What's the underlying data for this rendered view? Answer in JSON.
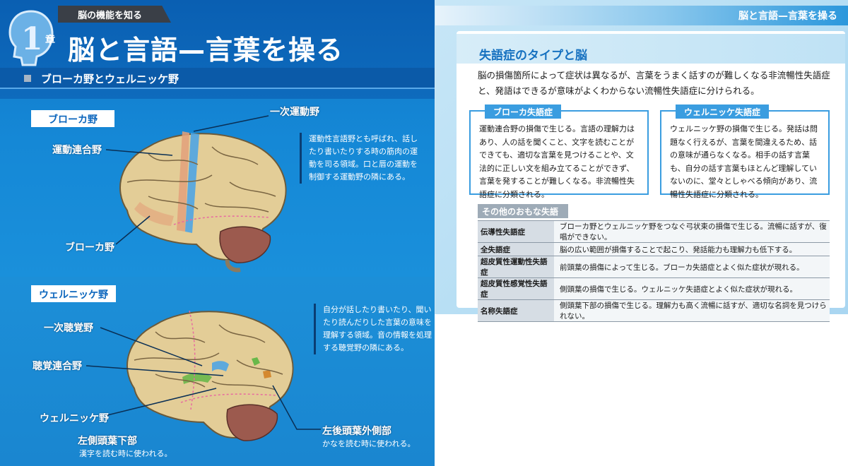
{
  "left": {
    "chapter_tab": "脳の機能を知る",
    "chapter_number": "1",
    "chapter_kanji": "章",
    "title": "脳と言語—言葉を操る",
    "section": "ブローカ野とウェルニッケ野",
    "broca": {
      "tag": "ブローカ野",
      "labels": {
        "primary_motor": "一次運動野",
        "motor_association": "運動連合野",
        "broca": "ブローカ野"
      },
      "description": "運動性言語野とも呼ばれ、話したり書いたりする時の筋肉の運動を司る領域。口と唇の運動を制御する運動野の隣にある。"
    },
    "wernicke": {
      "tag": "ウェルニッケ野",
      "labels": {
        "primary_auditory": "一次聴覚野",
        "auditory_association": "聴覚連合野",
        "wernicke": "ウェルニッケ野",
        "left_inferior_temporal": "左側頭葉下部",
        "left_inferior_temporal_note": "漢字を読む時に使われる。",
        "left_posterior_temporal": "左後頭葉外側部",
        "left_posterior_temporal_note": "かなを読む時に使われる。"
      },
      "description": "自分が話したり書いたり、聞いたり読んだりした言葉の意味を理解する領域。音の情報を処理する聴覚野の隣にある。"
    }
  },
  "right": {
    "header": "脳と言語—言葉を操る",
    "title": "失語症のタイプと脳",
    "intro": "脳の損傷箇所によって症状は異なるが、言葉をうまく話すのが難しくなる非流暢性失語症と、発語はできるが意味がよくわからない流暢性失語症に分けられる。",
    "broca_type": {
      "tag": "ブローカ失語症",
      "text": "運動連合野の損傷で生じる。言語の理解力はあり、人の話を聞くこと、文字を読むことができても、適切な言葉を見つけることや、文法的に正しい文を組み立てることができず、言葉を発することが難しくなる。非流暢性失語症に分類される。"
    },
    "wernicke_type": {
      "tag": "ウェルニッケ失語症",
      "text": "ウェルニッケ野の損傷で生じる。発話は問題なく行えるが、言葉を間違えるため、話の意味が通らなくなる。相手の話す言葉も、自分の話す言葉もほとんど理解していないのに、堂々としゃべる傾向があり、流暢性失語症に分類される。"
    },
    "other_tag": "その他のおもな失語症",
    "other": [
      {
        "name": "伝導性失語症",
        "desc": "ブローカ野とウェルニッケ野をつなぐ弓状束の損傷で生じる。流暢に話すが、復唱ができない。"
      },
      {
        "name": "全失語症",
        "desc": "脳の広い範囲が損傷することで起こり、発話能力も理解力も低下する。"
      },
      {
        "name": "超皮質性運動性失語症",
        "desc": "前頭葉の損傷によって生じる。ブローカ失語症とよく似た症状が現れる。"
      },
      {
        "name": "超皮質性感覚性失語症",
        "desc": "側頭葉の損傷で生じる。ウェルニッケ失語症とよく似た症状が現れる。"
      },
      {
        "name": "名称失語症",
        "desc": "側頭葉下部の損傷で生じる。理解力も高く流暢に話すが、適切な名詞を見つけられない。"
      }
    ]
  },
  "colors": {
    "blue_page": "#1588d6",
    "dark_band": "#0a5fb2",
    "brain": "#e3cd97",
    "broca_highlight": "#e3a07a",
    "motor_highlight": "#4fa5e3",
    "cerebellum": "#9c5a4e",
    "accent_green": "#69b84a"
  }
}
